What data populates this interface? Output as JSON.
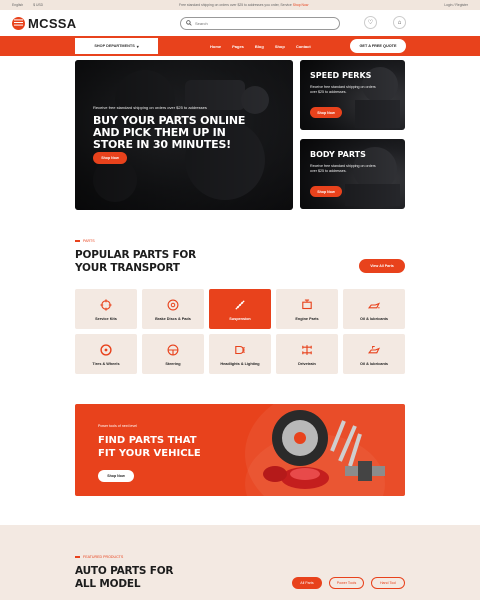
{
  "topbar": {
    "language": "English",
    "currency": "$ USD",
    "promo_text": "Free standard shipping on orders over $25 to addresses you order, Service",
    "promo_link": "Shop Now",
    "login_text": "Login / Register"
  },
  "header": {
    "logo": "MCSSA",
    "search_placeholder": "Search",
    "wishlist_icon": "heart-icon",
    "cart_icon": "cart-icon",
    "cart_count": "0"
  },
  "nav": {
    "departments_label": "SHOP DEPARTMENTS",
    "items": [
      "Home",
      "Pages",
      "Blog",
      "Shop",
      "Contact"
    ],
    "quote_label": "GET A FREE QUOTE"
  },
  "hero": {
    "subtitle": "Receive free standard shipping on orders over $25 to addresses",
    "title": "BUY YOUR PARTS ONLINE AND PICK THEM UP IN STORE IN 30 MINUTES!",
    "button": "Shop Now"
  },
  "promo_cards": [
    {
      "title": "SPEED PERKS",
      "text": "Receive free standard shipping on orders over $25 to addresses.",
      "button": "Shop Now"
    },
    {
      "title": "BODY PARTS",
      "text": "Receive free standard shipping on orders over $25 to addresses.",
      "button": "Shop Now"
    }
  ],
  "categories_section": {
    "tag": "PARTS",
    "title": "POPULAR PARTS FOR YOUR TRANSPORT",
    "view_all": "View All Parts",
    "items": [
      "Service Kits",
      "Brake Discs & Pads",
      "Suspension",
      "Engine Parts",
      "Oil & lubricants",
      "Tires & Wheels",
      "Steering",
      "Headlights & Lighting",
      "Drivetrain",
      "Oil & lubricants"
    ]
  },
  "banner": {
    "subtitle": "Power tools of next level",
    "title": "FIND PARTS THAT FIT YOUR VEHICLE",
    "button": "Shop Now"
  },
  "featured": {
    "tag": "FEATURED PRODUCTS",
    "title": "AUTO PARTS FOR ALL MODEL",
    "tabs": [
      "All Parts",
      "Power Tools",
      "Hand Tool"
    ]
  },
  "colors": {
    "accent": "#e8421c",
    "beige": "#f3e9e2",
    "dark": "#1d1d1d"
  }
}
